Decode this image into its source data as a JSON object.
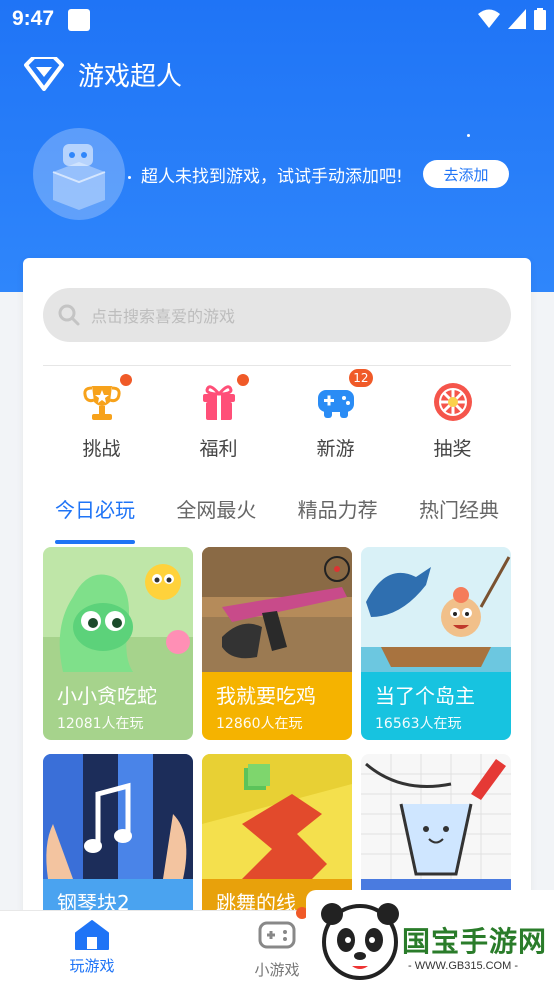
{
  "status_bar": {
    "time": "9:47"
  },
  "app": {
    "title": "游戏超人"
  },
  "empty_banner": {
    "message": "超人未找到游戏，试试手动添加吧!",
    "add_button_label": "去添加"
  },
  "search": {
    "placeholder": "点击搜索喜爱的游戏"
  },
  "quick_actions": [
    {
      "label": "挑战",
      "icon": "trophy-icon",
      "badge": "dot"
    },
    {
      "label": "福利",
      "icon": "gift-icon",
      "badge": "dot"
    },
    {
      "label": "新游",
      "icon": "gamepad-icon",
      "badge": "12"
    },
    {
      "label": "抽奖",
      "icon": "lottery-wheel-icon",
      "badge": ""
    }
  ],
  "tabs": [
    {
      "label": "今日必玩",
      "active": true
    },
    {
      "label": "全网最火",
      "active": false
    },
    {
      "label": "精品力荐",
      "active": false
    },
    {
      "label": "热门经典",
      "active": false
    }
  ],
  "games": [
    {
      "name": "小小贪吃蛇",
      "players": "12081人在玩",
      "color": "#a6d38c"
    },
    {
      "name": "我就要吃鸡",
      "players": "12860人在玩",
      "color": "#f5b300"
    },
    {
      "name": "当了个岛主",
      "players": "16563人在玩",
      "color": "#17c3e0"
    },
    {
      "name": "钢琴块2",
      "players": "",
      "color": "#4aa3f0"
    },
    {
      "name": "跳舞的线",
      "players": "",
      "color": "#e8a10b"
    },
    {
      "name": "",
      "players": "",
      "color": "#4a7be0"
    }
  ],
  "bottom_nav": [
    {
      "label": "玩游戏",
      "active": true
    },
    {
      "label": "小游戏",
      "active": false
    }
  ],
  "watermark": {
    "brand": "国宝手游网",
    "url": "- WWW.GB315.COM -"
  },
  "colors": {
    "primary": "#1f74f6",
    "badge": "#f05a28"
  }
}
